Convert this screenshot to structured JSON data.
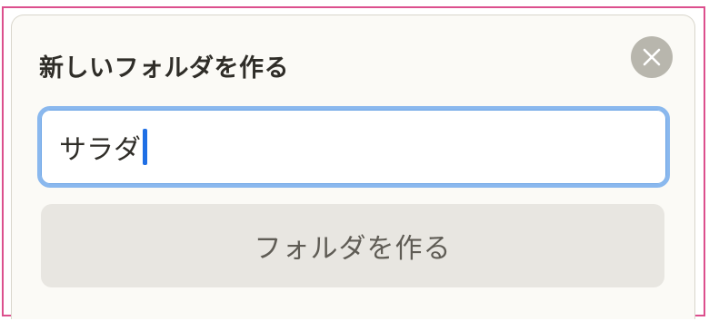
{
  "dialog": {
    "title": "新しいフォルダを作る",
    "close_icon": "close-x-icon",
    "input": {
      "value": "サラダ"
    },
    "submit_label": "フォルダを作る"
  },
  "colors": {
    "focus_border": "#8ab8ee",
    "caret": "#1f6fe5",
    "close_button_bg": "#b8b6ad",
    "submit_bg": "#e8e6e1",
    "outer_frame": "#dc4f8d"
  }
}
